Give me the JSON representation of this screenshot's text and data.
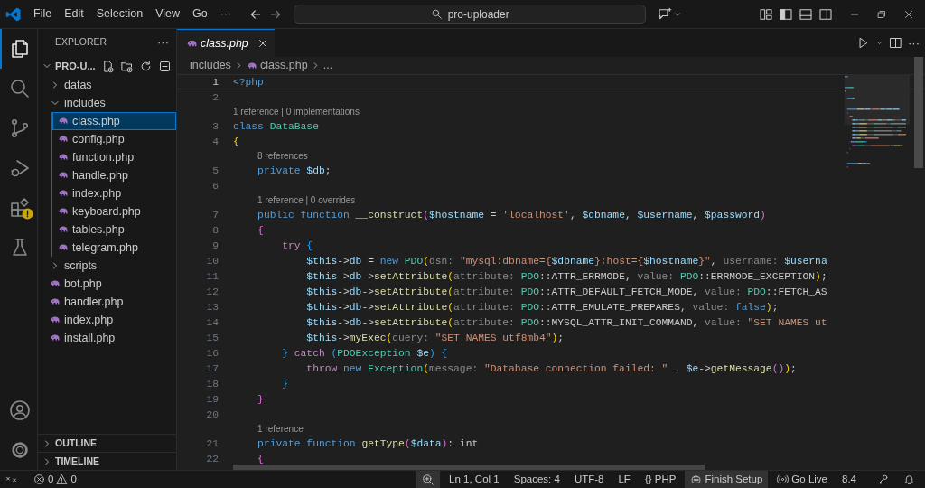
{
  "title_bar": {
    "menu": [
      "File",
      "Edit",
      "Selection",
      "View",
      "Go"
    ],
    "more": "···",
    "search": "pro-uploader"
  },
  "activity_bar": [
    {
      "selected": true,
      "warning_badge": false
    },
    {
      "selected": false,
      "warning_badge": false
    },
    {
      "selected": false,
      "warning_badge": false
    },
    {
      "selected": false,
      "warning_badge": false
    },
    {
      "selected": false,
      "warning_badge": true
    },
    {
      "selected": false,
      "warning_badge": false
    }
  ],
  "sidebar": {
    "title": "EXPLORER",
    "more": "···",
    "folder": {
      "label": "PRO-U...",
      "expanded": true
    },
    "tree": [
      {
        "label": "datas",
        "kind": "folder",
        "expanded": false,
        "selected": false
      },
      {
        "label": "includes",
        "kind": "folder",
        "expanded": true,
        "selected": false,
        "children": [
          {
            "label": "class.php",
            "kind": "file",
            "selected": true
          },
          {
            "label": "config.php",
            "kind": "file",
            "selected": false
          },
          {
            "label": "function.php",
            "kind": "file",
            "selected": false
          },
          {
            "label": "handle.php",
            "kind": "file",
            "selected": false
          },
          {
            "label": "index.php",
            "kind": "file",
            "selected": false
          },
          {
            "label": "keyboard.php",
            "kind": "file",
            "selected": false
          },
          {
            "label": "tables.php",
            "kind": "file",
            "selected": false
          },
          {
            "label": "telegram.php",
            "kind": "file",
            "selected": false
          }
        ]
      },
      {
        "label": "scripts",
        "kind": "folder",
        "expanded": false,
        "selected": false
      },
      {
        "label": "bot.php",
        "kind": "file",
        "selected": false
      },
      {
        "label": "handler.php",
        "kind": "file",
        "selected": false
      },
      {
        "label": "index.php",
        "kind": "file",
        "selected": false
      },
      {
        "label": "install.php",
        "kind": "file",
        "selected": false
      }
    ],
    "sections": [
      {
        "label": "OUTLINE",
        "expanded": false
      },
      {
        "label": "TIMELINE",
        "expanded": false
      }
    ]
  },
  "editor": {
    "tabs": [
      {
        "label": "class.php",
        "selected": true,
        "preview": true
      }
    ],
    "more": "···",
    "breadcrumbs": [
      "includes",
      "class.php",
      "..."
    ],
    "lines": [
      {
        "kind": "code",
        "number": "1",
        "current": true,
        "tokens": [
          {
            "kind": "keyword",
            "text": "<?php"
          }
        ]
      },
      {
        "kind": "code",
        "number": "2",
        "current": false
      },
      {
        "kind": "lens",
        "text": "1 reference | 0 implementations"
      },
      {
        "kind": "code",
        "number": "3",
        "current": false,
        "tokens": [
          {
            "kind": "keyword",
            "text": "class "
          },
          {
            "kind": "type",
            "text": "DataBase"
          }
        ]
      },
      {
        "kind": "code",
        "number": "4",
        "current": false,
        "tokens": [
          {
            "kind": "brace1",
            "text": "{"
          }
        ]
      },
      {
        "kind": "lens",
        "text": "8 references"
      },
      {
        "kind": "code",
        "number": "5",
        "current": false,
        "tokens": [
          {
            "kind": "keyword",
            "text": "    private "
          },
          {
            "kind": "variable",
            "text": "$db"
          },
          {
            "kind": "plain",
            "text": ";"
          }
        ]
      },
      {
        "kind": "code",
        "number": "6",
        "current": false
      },
      {
        "kind": "lens",
        "text": "1 reference | 0 overrides"
      },
      {
        "kind": "code",
        "number": "7",
        "current": false,
        "tokens": [
          {
            "kind": "keyword",
            "text": "    public function "
          },
          {
            "kind": "function",
            "text": "__construct"
          },
          {
            "kind": "brace2",
            "text": "("
          },
          {
            "kind": "variable",
            "text": "$hostname"
          },
          {
            "kind": "plain",
            "text": " = "
          },
          {
            "kind": "string",
            "text": "'localhost'"
          },
          {
            "kind": "plain",
            "text": ", "
          },
          {
            "kind": "variable",
            "text": "$dbname"
          },
          {
            "kind": "plain",
            "text": ", "
          },
          {
            "kind": "variable",
            "text": "$username"
          },
          {
            "kind": "plain",
            "text": ", "
          },
          {
            "kind": "variable",
            "text": "$password"
          },
          {
            "kind": "brace2",
            "text": ")"
          }
        ]
      },
      {
        "kind": "code",
        "number": "8",
        "current": false,
        "tokens": [
          {
            "kind": "brace2",
            "text": "    {"
          }
        ]
      },
      {
        "kind": "code",
        "number": "9",
        "current": false,
        "tokens": [
          {
            "kind": "control",
            "text": "        try "
          },
          {
            "kind": "brace3",
            "text": "{"
          }
        ]
      },
      {
        "kind": "code",
        "number": "10",
        "current": false,
        "tokens": [
          {
            "kind": "variable",
            "text": "            $this"
          },
          {
            "kind": "plain",
            "text": "->"
          },
          {
            "kind": "variable",
            "text": "db"
          },
          {
            "kind": "plain",
            "text": " = "
          },
          {
            "kind": "keyword",
            "text": "new "
          },
          {
            "kind": "type",
            "text": "PDO"
          },
          {
            "kind": "brace1",
            "text": "("
          },
          {
            "kind": "hint",
            "text": "dsn: "
          },
          {
            "kind": "string",
            "text": "\"mysql:dbname={"
          },
          {
            "kind": "variable",
            "text": "$dbname"
          },
          {
            "kind": "string",
            "text": "};host={"
          },
          {
            "kind": "variable",
            "text": "$hostname"
          },
          {
            "kind": "string",
            "text": "}\""
          },
          {
            "kind": "plain",
            "text": ", "
          },
          {
            "kind": "hint",
            "text": "username: "
          },
          {
            "kind": "variable",
            "text": "$userna"
          }
        ]
      },
      {
        "kind": "code",
        "number": "11",
        "current": false,
        "tokens": [
          {
            "kind": "variable",
            "text": "            $this"
          },
          {
            "kind": "plain",
            "text": "->"
          },
          {
            "kind": "variable",
            "text": "db"
          },
          {
            "kind": "plain",
            "text": "->"
          },
          {
            "kind": "function",
            "text": "setAttribute"
          },
          {
            "kind": "brace1",
            "text": "("
          },
          {
            "kind": "hint",
            "text": "attribute: "
          },
          {
            "kind": "type",
            "text": "PDO"
          },
          {
            "kind": "plain",
            "text": "::ATTR_ERRMODE, "
          },
          {
            "kind": "hint",
            "text": "value: "
          },
          {
            "kind": "type",
            "text": "PDO"
          },
          {
            "kind": "plain",
            "text": "::ERRMODE_EXCEPTION"
          },
          {
            "kind": "brace1",
            "text": ")"
          },
          {
            "kind": "plain",
            "text": ";"
          }
        ]
      },
      {
        "kind": "code",
        "number": "12",
        "current": false,
        "tokens": [
          {
            "kind": "variable",
            "text": "            $this"
          },
          {
            "kind": "plain",
            "text": "->"
          },
          {
            "kind": "variable",
            "text": "db"
          },
          {
            "kind": "plain",
            "text": "->"
          },
          {
            "kind": "function",
            "text": "setAttribute"
          },
          {
            "kind": "brace1",
            "text": "("
          },
          {
            "kind": "hint",
            "text": "attribute: "
          },
          {
            "kind": "type",
            "text": "PDO"
          },
          {
            "kind": "plain",
            "text": "::ATTR_DEFAULT_FETCH_MODE, "
          },
          {
            "kind": "hint",
            "text": "value: "
          },
          {
            "kind": "type",
            "text": "PDO"
          },
          {
            "kind": "plain",
            "text": "::FETCH_AS"
          }
        ]
      },
      {
        "kind": "code",
        "number": "13",
        "current": false,
        "tokens": [
          {
            "kind": "variable",
            "text": "            $this"
          },
          {
            "kind": "plain",
            "text": "->"
          },
          {
            "kind": "variable",
            "text": "db"
          },
          {
            "kind": "plain",
            "text": "->"
          },
          {
            "kind": "function",
            "text": "setAttribute"
          },
          {
            "kind": "brace1",
            "text": "("
          },
          {
            "kind": "hint",
            "text": "attribute: "
          },
          {
            "kind": "type",
            "text": "PDO"
          },
          {
            "kind": "plain",
            "text": "::ATTR_EMULATE_PREPARES, "
          },
          {
            "kind": "hint",
            "text": "value: "
          },
          {
            "kind": "keyword",
            "text": "false"
          },
          {
            "kind": "brace1",
            "text": ")"
          },
          {
            "kind": "plain",
            "text": ";"
          }
        ]
      },
      {
        "kind": "code",
        "number": "14",
        "current": false,
        "tokens": [
          {
            "kind": "variable",
            "text": "            $this"
          },
          {
            "kind": "plain",
            "text": "->"
          },
          {
            "kind": "variable",
            "text": "db"
          },
          {
            "kind": "plain",
            "text": "->"
          },
          {
            "kind": "function",
            "text": "setAttribute"
          },
          {
            "kind": "brace1",
            "text": "("
          },
          {
            "kind": "hint",
            "text": "attribute: "
          },
          {
            "kind": "type",
            "text": "PDO"
          },
          {
            "kind": "plain",
            "text": "::MYSQL_ATTR_INIT_COMMAND, "
          },
          {
            "kind": "hint",
            "text": "value: "
          },
          {
            "kind": "string",
            "text": "\"SET NAMES ut"
          }
        ]
      },
      {
        "kind": "code",
        "number": "15",
        "current": false,
        "tokens": [
          {
            "kind": "variable",
            "text": "            $this"
          },
          {
            "kind": "plain",
            "text": "->"
          },
          {
            "kind": "function",
            "text": "myExec"
          },
          {
            "kind": "brace1",
            "text": "("
          },
          {
            "kind": "hint",
            "text": "query: "
          },
          {
            "kind": "string",
            "text": "\"SET NAMES utf8mb4\""
          },
          {
            "kind": "brace1",
            "text": ")"
          },
          {
            "kind": "plain",
            "text": ";"
          }
        ]
      },
      {
        "kind": "code",
        "number": "16",
        "current": false,
        "tokens": [
          {
            "kind": "brace3",
            "text": "        }"
          },
          {
            "kind": "control",
            "text": " catch "
          },
          {
            "kind": "brace3",
            "text": "("
          },
          {
            "kind": "type",
            "text": "PDOException "
          },
          {
            "kind": "variable",
            "text": "$e"
          },
          {
            "kind": "brace3",
            "text": ") {"
          }
        ]
      },
      {
        "kind": "code",
        "number": "17",
        "current": false,
        "tokens": [
          {
            "kind": "control",
            "text": "            throw "
          },
          {
            "kind": "keyword",
            "text": "new "
          },
          {
            "kind": "type",
            "text": "Exception"
          },
          {
            "kind": "brace1",
            "text": "("
          },
          {
            "kind": "hint",
            "text": "message: "
          },
          {
            "kind": "string",
            "text": "\"Database connection failed: \""
          },
          {
            "kind": "plain",
            "text": " . "
          },
          {
            "kind": "variable",
            "text": "$e"
          },
          {
            "kind": "plain",
            "text": "->"
          },
          {
            "kind": "function",
            "text": "getMessage"
          },
          {
            "kind": "brace2",
            "text": "()"
          },
          {
            "kind": "brace1",
            "text": ")"
          },
          {
            "kind": "plain",
            "text": ";"
          }
        ]
      },
      {
        "kind": "code",
        "number": "18",
        "current": false,
        "tokens": [
          {
            "kind": "brace3",
            "text": "        }"
          }
        ]
      },
      {
        "kind": "code",
        "number": "19",
        "current": false,
        "tokens": [
          {
            "kind": "brace2",
            "text": "    }"
          }
        ]
      },
      {
        "kind": "code",
        "number": "20",
        "current": false
      },
      {
        "kind": "lens",
        "text": "1 reference"
      },
      {
        "kind": "code",
        "number": "21",
        "current": false,
        "tokens": [
          {
            "kind": "keyword",
            "text": "    private function "
          },
          {
            "kind": "function",
            "text": "getType"
          },
          {
            "kind": "brace2",
            "text": "("
          },
          {
            "kind": "variable",
            "text": "$data"
          },
          {
            "kind": "brace2",
            "text": ")"
          },
          {
            "kind": "plain",
            "text": ": int"
          }
        ]
      },
      {
        "kind": "code",
        "number": "22",
        "current": false,
        "tokens": [
          {
            "kind": "brace2",
            "text": "    {"
          }
        ]
      }
    ]
  },
  "status_bar": {
    "errors": "0",
    "warnings": "0",
    "items": [
      {
        "text": "Ln 1, Col 1",
        "highlighted": false
      },
      {
        "text": "Spaces: 4",
        "highlighted": false
      },
      {
        "text": "UTF-8",
        "highlighted": false
      },
      {
        "text": "LF",
        "highlighted": false
      },
      {
        "text": "{} PHP",
        "highlighted": false
      },
      {
        "text": "Finish Setup",
        "highlighted": true
      },
      {
        "text": "Go Live",
        "highlighted": false
      },
      {
        "text": "8.4",
        "highlighted": false
      }
    ]
  }
}
